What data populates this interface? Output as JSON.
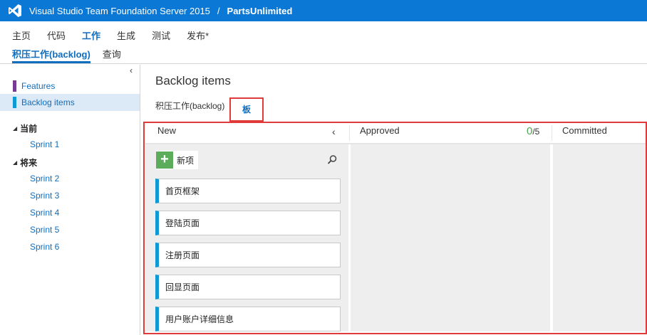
{
  "topbar": {
    "product": "Visual Studio Team Foundation Server 2015",
    "separator": "/",
    "project": "PartsUnlimited",
    "logo_icon": "visual-studio-logo-icon",
    "background": "#0a78d4"
  },
  "main_nav": {
    "items": [
      {
        "label": "主页"
      },
      {
        "label": "代码"
      },
      {
        "label": "工作"
      },
      {
        "label": "生成"
      },
      {
        "label": "测试"
      },
      {
        "label": "发布*"
      }
    ],
    "active": "工作"
  },
  "sub_nav": {
    "items": [
      {
        "label": "积压工作(backlog)"
      },
      {
        "label": "查询"
      }
    ],
    "active": "积压工作(backlog)"
  },
  "left_pane": {
    "collapse_icon": "chevron-left-icon",
    "backlogs": [
      {
        "label": "Features",
        "color": "#773b93"
      },
      {
        "label": "Backlog items",
        "color": "#0e99d6",
        "selected": true
      }
    ],
    "groups": [
      {
        "label": "当前",
        "sprints": [
          "Sprint 1"
        ]
      },
      {
        "label": "将来",
        "sprints": [
          "Sprint 2",
          "Sprint 3",
          "Sprint 4",
          "Sprint 5",
          "Sprint 6"
        ]
      }
    ]
  },
  "content": {
    "title": "Backlog items",
    "tabs": [
      {
        "label": "积压工作(backlog)"
      },
      {
        "label": "板",
        "active": true
      }
    ]
  },
  "board": {
    "columns": [
      {
        "name": "New"
      },
      {
        "name": "Approved",
        "wip_current": "0",
        "wip_limit": "/5"
      },
      {
        "name": "Committed"
      }
    ],
    "new_item_label": "新项",
    "cards": [
      {
        "title": "首页框架"
      },
      {
        "title": "登陆页面"
      },
      {
        "title": "注册页面"
      },
      {
        "title": "回显页面"
      },
      {
        "title": "用户账户详细信息"
      }
    ],
    "card_accent_color": "#0e99d6",
    "highlight_color": "#e13a3a"
  }
}
